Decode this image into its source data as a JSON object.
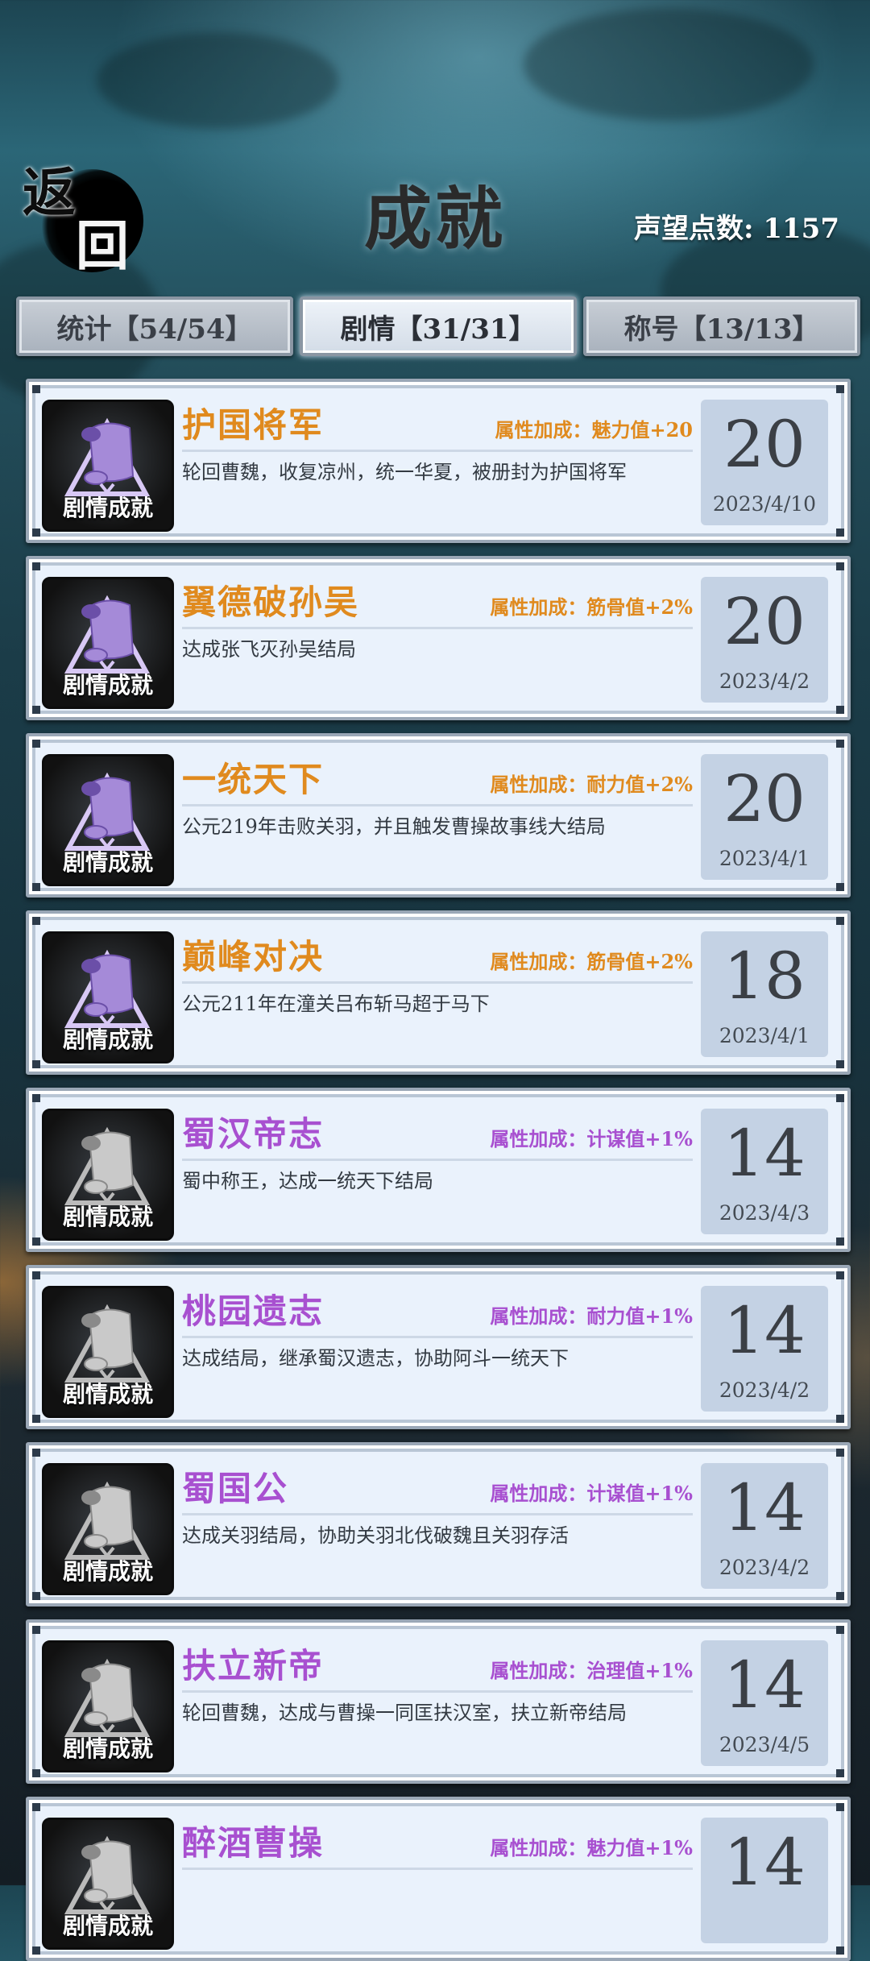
{
  "header": {
    "back_char_1": "返",
    "back_char_2": "回",
    "title": "成就",
    "reputation": "声望点数: 1157"
  },
  "tabs": [
    {
      "label": "统计【54/54】",
      "active": false
    },
    {
      "label": "剧情【31/31】",
      "active": true
    },
    {
      "label": "称号【13/13】",
      "active": false
    }
  ],
  "badge_label": "剧情成就",
  "achievements": [
    {
      "title": "护国将军",
      "bonus": "属性加成：魅力值+20",
      "desc": "轮回曹魏，收复凉州，统一华夏，被册封为护国将军",
      "score": "20",
      "date": "2023/4/10",
      "tier": "gold"
    },
    {
      "title": "翼德破孙吴",
      "bonus": "属性加成：筋骨值+2%",
      "desc": "达成张飞灭孙吴结局",
      "score": "20",
      "date": "2023/4/2",
      "tier": "gold"
    },
    {
      "title": "一统天下",
      "bonus": "属性加成：耐力值+2%",
      "desc": "公元219年击败关羽，并且触发曹操故事线大结局",
      "score": "20",
      "date": "2023/4/1",
      "tier": "gold"
    },
    {
      "title": "巅峰对决",
      "bonus": "属性加成：筋骨值+2%",
      "desc": "公元211年在潼关吕布斩马超于马下",
      "score": "18",
      "date": "2023/4/1",
      "tier": "gold"
    },
    {
      "title": "蜀汉帝志",
      "bonus": "属性加成：计谋值+1%",
      "desc": "蜀中称王，达成一统天下结局",
      "score": "14",
      "date": "2023/4/3",
      "tier": "purple"
    },
    {
      "title": "桃园遗志",
      "bonus": "属性加成：耐力值+1%",
      "desc": "达成结局，继承蜀汉遗志，协助阿斗一统天下",
      "score": "14",
      "date": "2023/4/2",
      "tier": "purple"
    },
    {
      "title": "蜀国公",
      "bonus": "属性加成：计谋值+1%",
      "desc": "达成关羽结局，协助关羽北伐破魏且关羽存活",
      "score": "14",
      "date": "2023/4/2",
      "tier": "purple"
    },
    {
      "title": "扶立新帝",
      "bonus": "属性加成：治理值+1%",
      "desc": "轮回曹魏，达成与曹操一同匡扶汉室，扶立新帝结局",
      "score": "14",
      "date": "2023/4/5",
      "tier": "purple"
    },
    {
      "title": "醉酒曹操",
      "bonus": "属性加成：魅力值+1%",
      "desc": "",
      "score": "14",
      "date": "",
      "tier": "purple"
    }
  ],
  "colors": {
    "gold": "#e08a1e",
    "purple": "#a850d0"
  }
}
